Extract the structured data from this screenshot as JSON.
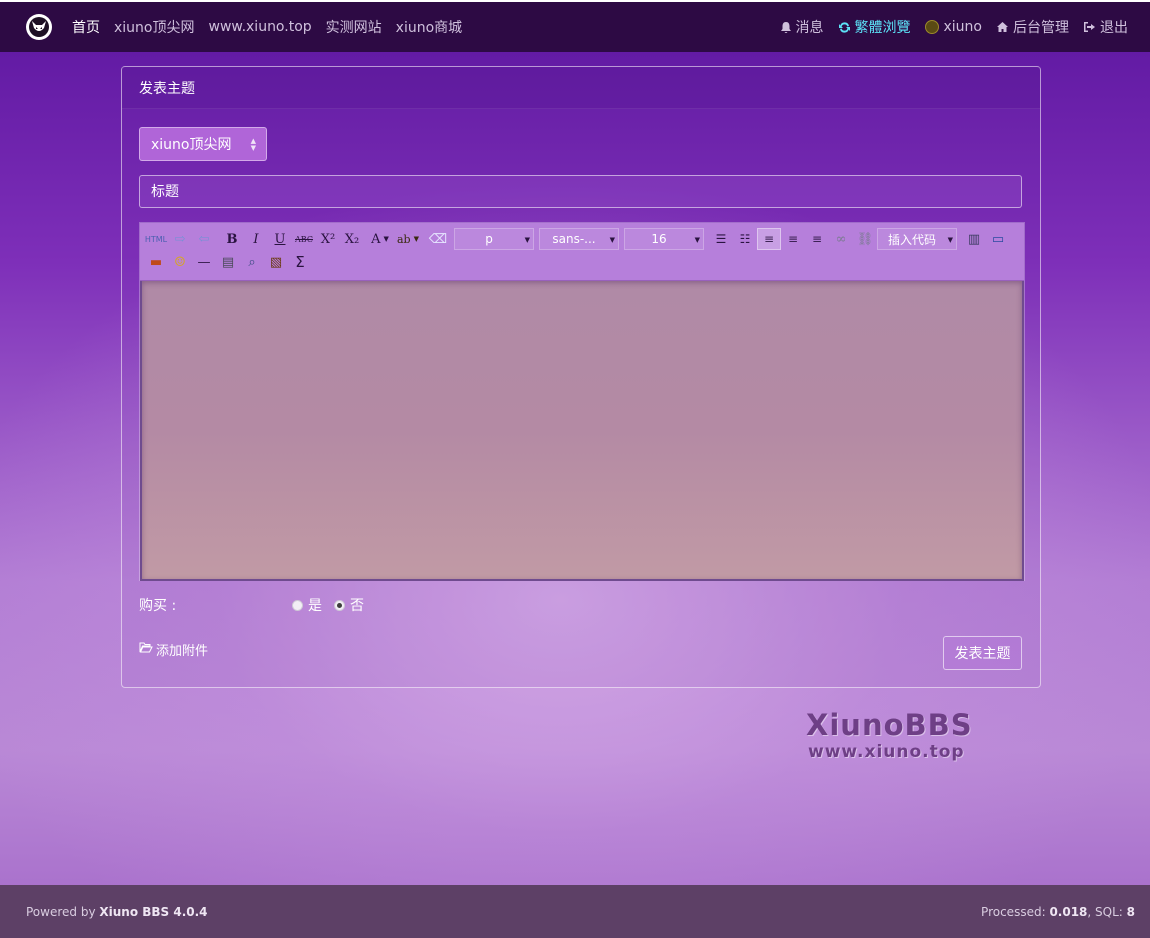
{
  "nav": {
    "home": "首页",
    "links": [
      "xiuno顶尖网",
      "www.xiuno.top",
      "实测网站",
      "xiuno商城"
    ],
    "messages": "消息",
    "traditional": "繁體浏覽",
    "user": "xiuno",
    "admin": "后台管理",
    "logout": "退出"
  },
  "card": {
    "header": "发表主题",
    "forum_selected": "xiuno顶尖网",
    "title_placeholder": "标题",
    "toolbar": {
      "html_label": "HTML",
      "bold": "B",
      "italic": "I",
      "underline": "U",
      "strike": "ABC",
      "sup": "X²",
      "sub": "X₂",
      "forecolor": "A",
      "backcolor": "ab",
      "format": "p",
      "font_family": "sans-...",
      "font_size": "16",
      "insert_code": "插入代码",
      "sigma": "Σ"
    },
    "buy_label": "购买 :",
    "buy_options": [
      "是",
      "否"
    ],
    "attach": "添加附件",
    "submit": "发表主题"
  },
  "watermark": {
    "line1": "XiunoBBS",
    "line2": "www.xiuno.top"
  },
  "footer": {
    "powered_prefix": "Powered by ",
    "powered_name": "Xiuno BBS 4.0.4",
    "processed_prefix": "Processed: ",
    "processed_value": "0.018",
    "sql_prefix": ", SQL: ",
    "sql_value": "8"
  },
  "colors": {
    "nav_bg": "#2d0a44",
    "accent_cyan": "#5ce1f6",
    "footer_bg": "#5d4066"
  }
}
